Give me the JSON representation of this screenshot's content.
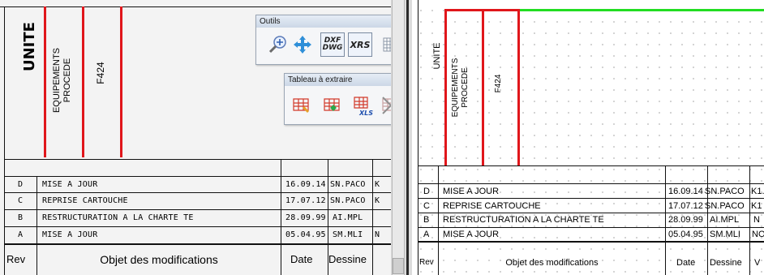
{
  "drawing": {
    "block_labels": [
      "UNITE",
      "EQUIPEMENTS\nPROCEDE",
      "F424"
    ],
    "rows": [
      {
        "rev": "D",
        "object": "MISE A JOUR",
        "date": "16.09.14",
        "drawer": "SN.PACO",
        "extra": "K"
      },
      {
        "rev": "C",
        "object": "REPRISE CARTOUCHE",
        "date": "17.07.12",
        "drawer": "SN.PACO",
        "extra": "K"
      },
      {
        "rev": "B",
        "object": "RESTRUCTURATION A LA CHARTE TE",
        "date": "28.09.99",
        "drawer": "AI.MPL",
        "extra": ""
      },
      {
        "rev": "A",
        "object": "MISE A JOUR",
        "date": "05.04.95",
        "drawer": "SM.MLI",
        "extra": "N"
      }
    ],
    "header": {
      "rev": "Rev",
      "object": "Objet des modifications",
      "date": "Date",
      "drawer": "Dessine"
    },
    "right_rows": [
      {
        "rev": "D",
        "object": "MISE A JOUR",
        "date": "16.09.14",
        "drawer": "SN.PACO",
        "extra": "K1."
      },
      {
        "rev": "C",
        "object": "REPRISE CARTOUCHE",
        "date": "17.07.12",
        "drawer": "SN.PACO",
        "extra": "K1"
      },
      {
        "rev": "B",
        "object": "RESTRUCTURATION A LA CHARTE TE",
        "date": "28.09.99",
        "drawer": "AI.MPL",
        "extra": "N"
      },
      {
        "rev": "A",
        "object": "MISE A JOUR",
        "date": "05.04.95",
        "drawer": "SM.MLI",
        "extra": "NO"
      }
    ],
    "right_header": {
      "rev": "Rev",
      "object": "Objet des modifications",
      "date": "Date",
      "drawer": "Dessine",
      "extra": "V"
    }
  },
  "toolbars": {
    "outils": {
      "title": "Outils",
      "buttons": [
        "zoom-icon",
        "pan-icon",
        "DXF\nDWG",
        "XRS",
        "grid-icon"
      ]
    },
    "tableau": {
      "title": "Tableau à extraire",
      "buttons": [
        "table-select-icon",
        "table-move-icon",
        "XLS",
        "table-delete-icon"
      ]
    }
  },
  "colors": {
    "red": "#e0161b",
    "green": "#22dd22"
  }
}
